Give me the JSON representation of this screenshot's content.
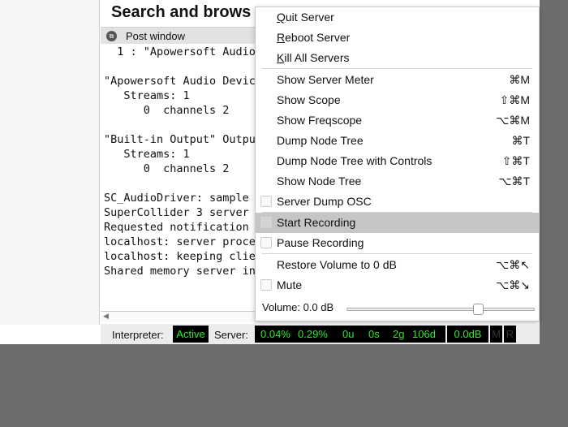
{
  "window": {
    "title": "Search and brows"
  },
  "post_window": {
    "title": "Post window",
    "lines": [
      "  1 : \"Apowersoft Audio",
      "",
      "\"Apowersoft Audio Device",
      "   Streams: 1",
      "      0  channels 2",
      "",
      "\"Built-in Output\" Output",
      "   Streams: 1",
      "      0  channels 2",
      "",
      "SC_AudioDriver: sample r",
      "SuperCollider 3 server r",
      "Requested notification m",
      "localhost: server proces",
      "localhost: keeping clien",
      "Shared memory server int"
    ]
  },
  "status": {
    "interpreter_label": "Interpreter:",
    "interpreter_state": "Active",
    "server_label": "Server:",
    "avg_cpu": "0.04%",
    "peak_cpu": "0.29%",
    "ugens": "0u",
    "synths": "0s",
    "groups": "2g",
    "synthdefs": "106d",
    "volume": "0.0dB",
    "mute": "M",
    "record": "R",
    "text_color": "#2ee82e"
  },
  "menu": {
    "items": [
      {
        "label_pre": "",
        "label_u": "Q",
        "label_post": "uit Server",
        "shortcut": ""
      },
      {
        "label_pre": "",
        "label_u": "R",
        "label_post": "eboot Server",
        "shortcut": ""
      },
      {
        "label_pre": "",
        "label_u": "K",
        "label_post": "ill All Servers",
        "shortcut": ""
      },
      {
        "label": "Show Server Meter",
        "shortcut": "⌘M"
      },
      {
        "label": "Show Scope",
        "shortcut": "⇧⌘M"
      },
      {
        "label": "Show Freqscope",
        "shortcut": "⌥⌘M"
      },
      {
        "label": "Dump Node Tree",
        "shortcut": "⌘T"
      },
      {
        "label": "Dump Node Tree with Controls",
        "shortcut": "⇧⌘T"
      },
      {
        "label": "Show Node Tree",
        "shortcut": "⌥⌘T"
      },
      {
        "label": "Server Dump OSC",
        "shortcut": "",
        "checked": false
      },
      {
        "label": "Start Recording",
        "shortcut": "",
        "checked": false,
        "highlighted": true
      },
      {
        "label": "Pause Recording",
        "shortcut": "",
        "checked": false
      },
      {
        "label": "Restore Volume to 0 dB",
        "shortcut": "⌥⌘↖"
      },
      {
        "label": "Mute",
        "shortcut": "⌥⌘↘",
        "checked": false
      }
    ],
    "volume_label": "Volume:  0.0 dB",
    "volume_slider_fraction": 0.7
  }
}
